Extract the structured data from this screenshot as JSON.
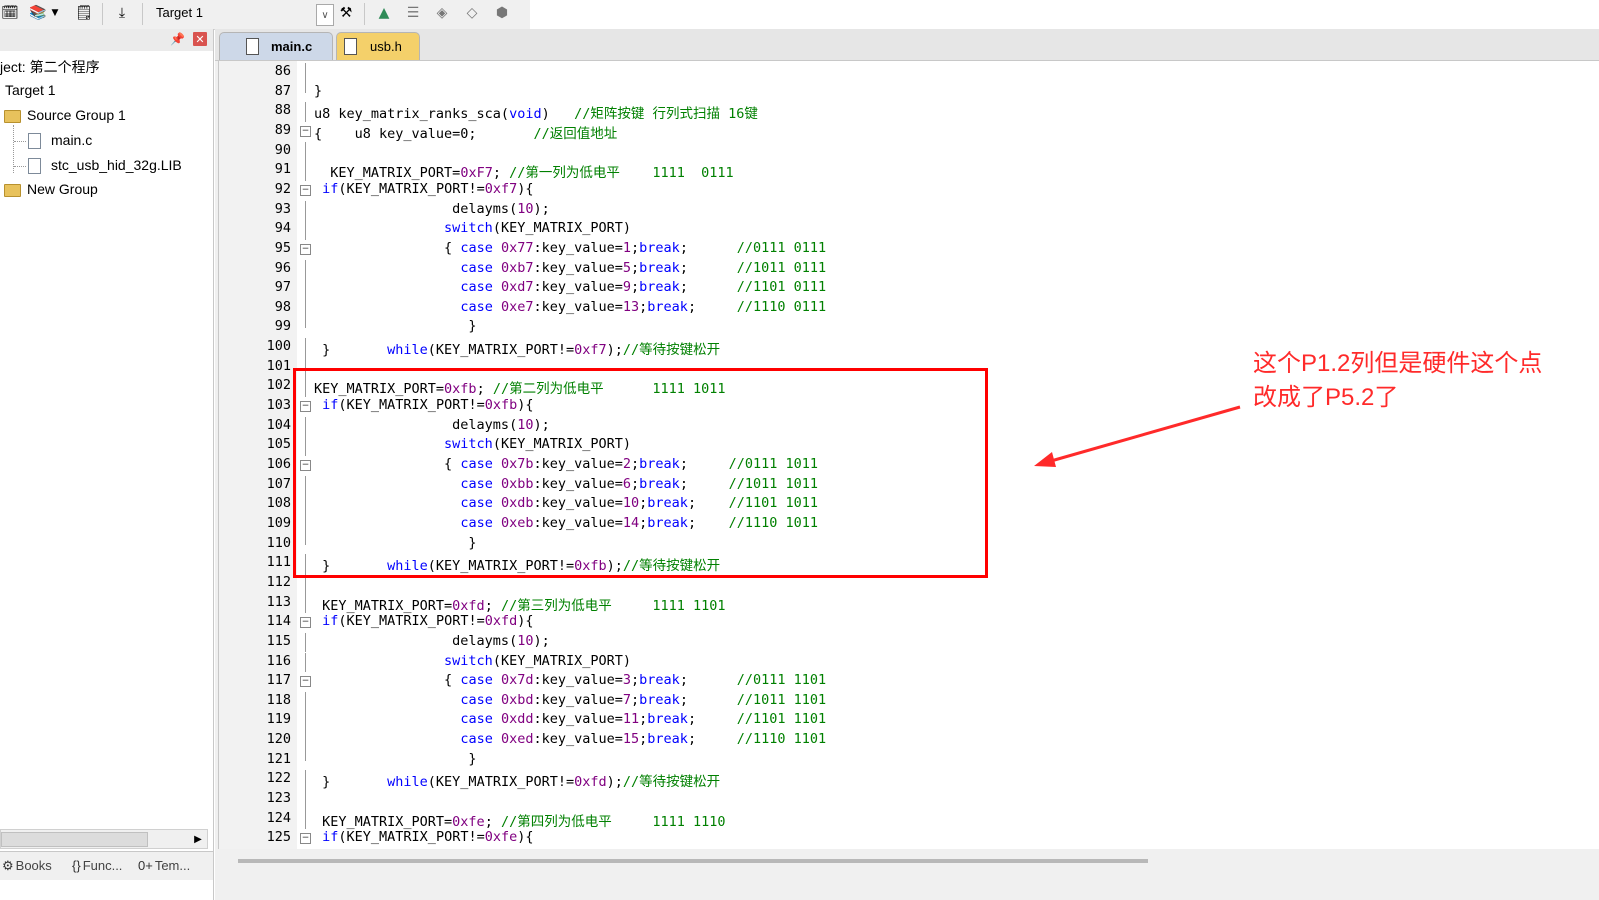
{
  "toolbar": {
    "target_name": "Target 1",
    "icons": [
      "build-target-icon",
      "batch-build-icon",
      "translate-icon",
      "download-icon",
      "options-for-target-icon",
      "manage-components-icon",
      "select-packs-icon",
      "pack-installer-icon",
      "event-recorder-icon",
      "pack-manager-icon"
    ]
  },
  "project": {
    "project_label": "ject: 第二个程序",
    "target_label": "Target 1",
    "group1_label": "Source Group 1",
    "file1": "main.c",
    "file2": "stc_usb_hid_32g.LIB",
    "group2_label": "New Group"
  },
  "bottom_tabs": {
    "books": "Books",
    "functions": "Func...",
    "templates": "Tem..."
  },
  "tabs": {
    "active": "main.c",
    "second": "usb.h"
  },
  "annotation": {
    "line1": "这个P1.2列但是硬件这个点",
    "line2": "改成了P5.2了"
  },
  "code": {
    "lines": [
      {
        "n": "86",
        "segs": [
          [
            "",
            ""
          ]
        ]
      },
      {
        "n": "87",
        "segs": [
          [
            "",
            "}"
          ]
        ]
      },
      {
        "n": "88",
        "segs": [
          [
            "",
            "u8 key_matrix_ranks_sca("
          ],
          [
            "kw",
            "void"
          ],
          [
            "",
            ")   "
          ],
          [
            "cm",
            "//矩阵按键 行列式扫描 16键"
          ]
        ]
      },
      {
        "n": "89",
        "segs": [
          [
            "",
            "{    u8 key_value=0;       "
          ],
          [
            "cm",
            "//返回值地址"
          ]
        ]
      },
      {
        "n": "90",
        "segs": [
          [
            "",
            ""
          ]
        ]
      },
      {
        "n": "91",
        "segs": [
          [
            "",
            "  KEY_MATRIX_PORT="
          ],
          [
            "num",
            "0xF7"
          ],
          [
            "",
            "; "
          ],
          [
            "cm",
            "//第一列为低电平    1111  0111"
          ]
        ]
      },
      {
        "n": "92",
        "segs": [
          [
            "",
            " "
          ],
          [
            "kw",
            "if"
          ],
          [
            "",
            "(KEY_MATRIX_PORT!="
          ],
          [
            "num",
            "0xf7"
          ],
          [
            "",
            "){"
          ]
        ]
      },
      {
        "n": "93",
        "segs": [
          [
            "",
            "                 delayms("
          ],
          [
            "num",
            "10"
          ],
          [
            "",
            ");"
          ]
        ]
      },
      {
        "n": "94",
        "segs": [
          [
            "",
            "                "
          ],
          [
            "kw",
            "switch"
          ],
          [
            "",
            "(KEY_MATRIX_PORT)"
          ]
        ]
      },
      {
        "n": "95",
        "segs": [
          [
            "",
            "                { "
          ],
          [
            "kw",
            "case"
          ],
          [
            "",
            " "
          ],
          [
            "num",
            "0x77"
          ],
          [
            "",
            ":key_value="
          ],
          [
            "num",
            "1"
          ],
          [
            "",
            ";"
          ],
          [
            "kw",
            "break"
          ],
          [
            "",
            ";      "
          ],
          [
            "cm",
            "//0111 0111"
          ]
        ]
      },
      {
        "n": "96",
        "segs": [
          [
            "",
            "                  "
          ],
          [
            "kw",
            "case"
          ],
          [
            "",
            " "
          ],
          [
            "num",
            "0xb7"
          ],
          [
            "",
            ":key_value="
          ],
          [
            "num",
            "5"
          ],
          [
            "",
            ";"
          ],
          [
            "kw",
            "break"
          ],
          [
            "",
            ";      "
          ],
          [
            "cm",
            "//1011 0111"
          ]
        ]
      },
      {
        "n": "97",
        "segs": [
          [
            "",
            "                  "
          ],
          [
            "kw",
            "case"
          ],
          [
            "",
            " "
          ],
          [
            "num",
            "0xd7"
          ],
          [
            "",
            ":key_value="
          ],
          [
            "num",
            "9"
          ],
          [
            "",
            ";"
          ],
          [
            "kw",
            "break"
          ],
          [
            "",
            ";      "
          ],
          [
            "cm",
            "//1101 0111"
          ]
        ]
      },
      {
        "n": "98",
        "segs": [
          [
            "",
            "                  "
          ],
          [
            "kw",
            "case"
          ],
          [
            "",
            " "
          ],
          [
            "num",
            "0xe7"
          ],
          [
            "",
            ":key_value="
          ],
          [
            "num",
            "13"
          ],
          [
            "",
            ";"
          ],
          [
            "kw",
            "break"
          ],
          [
            "",
            ";     "
          ],
          [
            "cm",
            "//1110 0111"
          ]
        ]
      },
      {
        "n": "99",
        "segs": [
          [
            "",
            "                   }"
          ]
        ]
      },
      {
        "n": "100",
        "segs": [
          [
            "",
            " }       "
          ],
          [
            "kw",
            "while"
          ],
          [
            "",
            "(KEY_MATRIX_PORT!="
          ],
          [
            "num",
            "0xf7"
          ],
          [
            "",
            ");"
          ],
          [
            "cm",
            "//等待按键松开"
          ]
        ]
      },
      {
        "n": "101",
        "segs": [
          [
            "",
            ""
          ]
        ]
      },
      {
        "n": "102",
        "segs": [
          [
            "",
            "KEY_MATRIX_PORT="
          ],
          [
            "num",
            "0xfb"
          ],
          [
            "",
            "; "
          ],
          [
            "cm",
            "//第二列为低电平      1111 1011"
          ]
        ]
      },
      {
        "n": "103",
        "segs": [
          [
            "",
            " "
          ],
          [
            "kw",
            "if"
          ],
          [
            "",
            "(KEY_MATRIX_PORT!="
          ],
          [
            "num",
            "0xfb"
          ],
          [
            "",
            "){"
          ]
        ]
      },
      {
        "n": "104",
        "segs": [
          [
            "",
            "                 delayms("
          ],
          [
            "num",
            "10"
          ],
          [
            "",
            ");"
          ]
        ]
      },
      {
        "n": "105",
        "segs": [
          [
            "",
            "                "
          ],
          [
            "kw",
            "switch"
          ],
          [
            "",
            "(KEY_MATRIX_PORT)"
          ]
        ]
      },
      {
        "n": "106",
        "segs": [
          [
            "",
            "                { "
          ],
          [
            "kw",
            "case"
          ],
          [
            "",
            " "
          ],
          [
            "num",
            "0x7b"
          ],
          [
            "",
            ":key_value="
          ],
          [
            "num",
            "2"
          ],
          [
            "",
            ";"
          ],
          [
            "kw",
            "break"
          ],
          [
            "",
            ";     "
          ],
          [
            "cm",
            "//0111 1011"
          ]
        ]
      },
      {
        "n": "107",
        "segs": [
          [
            "",
            "                  "
          ],
          [
            "kw",
            "case"
          ],
          [
            "",
            " "
          ],
          [
            "num",
            "0xbb"
          ],
          [
            "",
            ":key_value="
          ],
          [
            "num",
            "6"
          ],
          [
            "",
            ";"
          ],
          [
            "kw",
            "break"
          ],
          [
            "",
            ";     "
          ],
          [
            "cm",
            "//1011 1011"
          ]
        ]
      },
      {
        "n": "108",
        "segs": [
          [
            "",
            "                  "
          ],
          [
            "kw",
            "case"
          ],
          [
            "",
            " "
          ],
          [
            "num",
            "0xdb"
          ],
          [
            "",
            ":key_value="
          ],
          [
            "num",
            "10"
          ],
          [
            "",
            ";"
          ],
          [
            "kw",
            "break"
          ],
          [
            "",
            ";    "
          ],
          [
            "cm",
            "//1101 1011"
          ]
        ]
      },
      {
        "n": "109",
        "segs": [
          [
            "",
            "                  "
          ],
          [
            "kw",
            "case"
          ],
          [
            "",
            " "
          ],
          [
            "num",
            "0xeb"
          ],
          [
            "",
            ":key_value="
          ],
          [
            "num",
            "14"
          ],
          [
            "",
            ";"
          ],
          [
            "kw",
            "break"
          ],
          [
            "",
            ";    "
          ],
          [
            "cm",
            "//1110 1011"
          ]
        ]
      },
      {
        "n": "110",
        "segs": [
          [
            "",
            "                   }"
          ]
        ]
      },
      {
        "n": "111",
        "segs": [
          [
            "",
            " }       "
          ],
          [
            "kw",
            "while"
          ],
          [
            "",
            "(KEY_MATRIX_PORT!="
          ],
          [
            "num",
            "0xfb"
          ],
          [
            "",
            ");"
          ],
          [
            "cm",
            "//等待按键松开"
          ]
        ]
      },
      {
        "n": "112",
        "segs": [
          [
            "",
            ""
          ]
        ]
      },
      {
        "n": "113",
        "segs": [
          [
            "",
            " KEY_MATRIX_PORT="
          ],
          [
            "num",
            "0xfd"
          ],
          [
            "",
            "; "
          ],
          [
            "cm",
            "//第三列为低电平     1111 1101"
          ]
        ]
      },
      {
        "n": "114",
        "segs": [
          [
            "",
            " "
          ],
          [
            "kw",
            "if"
          ],
          [
            "",
            "(KEY_MATRIX_PORT!="
          ],
          [
            "num",
            "0xfd"
          ],
          [
            "",
            "){"
          ]
        ]
      },
      {
        "n": "115",
        "segs": [
          [
            "",
            "                 delayms("
          ],
          [
            "num",
            "10"
          ],
          [
            "",
            ");"
          ]
        ]
      },
      {
        "n": "116",
        "segs": [
          [
            "",
            "                "
          ],
          [
            "kw",
            "switch"
          ],
          [
            "",
            "(KEY_MATRIX_PORT)"
          ]
        ]
      },
      {
        "n": "117",
        "segs": [
          [
            "",
            "                { "
          ],
          [
            "kw",
            "case"
          ],
          [
            "",
            " "
          ],
          [
            "num",
            "0x7d"
          ],
          [
            "",
            ":key_value="
          ],
          [
            "num",
            "3"
          ],
          [
            "",
            ";"
          ],
          [
            "kw",
            "break"
          ],
          [
            "",
            ";      "
          ],
          [
            "cm",
            "//0111 1101"
          ]
        ]
      },
      {
        "n": "118",
        "segs": [
          [
            "",
            "                  "
          ],
          [
            "kw",
            "case"
          ],
          [
            "",
            " "
          ],
          [
            "num",
            "0xbd"
          ],
          [
            "",
            ":key_value="
          ],
          [
            "num",
            "7"
          ],
          [
            "",
            ";"
          ],
          [
            "kw",
            "break"
          ],
          [
            "",
            ";      "
          ],
          [
            "cm",
            "//1011 1101"
          ]
        ]
      },
      {
        "n": "119",
        "segs": [
          [
            "",
            "                  "
          ],
          [
            "kw",
            "case"
          ],
          [
            "",
            " "
          ],
          [
            "num",
            "0xdd"
          ],
          [
            "",
            ":key_value="
          ],
          [
            "num",
            "11"
          ],
          [
            "",
            ";"
          ],
          [
            "kw",
            "break"
          ],
          [
            "",
            ";     "
          ],
          [
            "cm",
            "//1101 1101"
          ]
        ]
      },
      {
        "n": "120",
        "segs": [
          [
            "",
            "                  "
          ],
          [
            "kw",
            "case"
          ],
          [
            "",
            " "
          ],
          [
            "num",
            "0xed"
          ],
          [
            "",
            ":key_value="
          ],
          [
            "num",
            "15"
          ],
          [
            "",
            ";"
          ],
          [
            "kw",
            "break"
          ],
          [
            "",
            ";     "
          ],
          [
            "cm",
            "//1110 1101"
          ]
        ]
      },
      {
        "n": "121",
        "segs": [
          [
            "",
            "                   }"
          ]
        ]
      },
      {
        "n": "122",
        "segs": [
          [
            "",
            " }       "
          ],
          [
            "kw",
            "while"
          ],
          [
            "",
            "(KEY_MATRIX_PORT!="
          ],
          [
            "num",
            "0xfd"
          ],
          [
            "",
            ");"
          ],
          [
            "cm",
            "//等待按键松开"
          ]
        ]
      },
      {
        "n": "123",
        "segs": [
          [
            "",
            ""
          ]
        ]
      },
      {
        "n": "124",
        "segs": [
          [
            "",
            " KEY_MATRIX_PORT="
          ],
          [
            "num",
            "0xfe"
          ],
          [
            "",
            "; "
          ],
          [
            "cm",
            "//第四列为低电平     1111 1110"
          ]
        ]
      },
      {
        "n": "125",
        "segs": [
          [
            "",
            " "
          ],
          [
            "kw",
            "if"
          ],
          [
            "",
            "(KEY_MATRIX_PORT!="
          ],
          [
            "num",
            "0xfe"
          ],
          [
            "",
            "){"
          ]
        ]
      }
    ]
  },
  "colors": {
    "keyword": "#0000ff",
    "comment": "#008000",
    "number": "#800080",
    "annotation": "#ff2a2a",
    "highlight_box": "#ff0000"
  }
}
